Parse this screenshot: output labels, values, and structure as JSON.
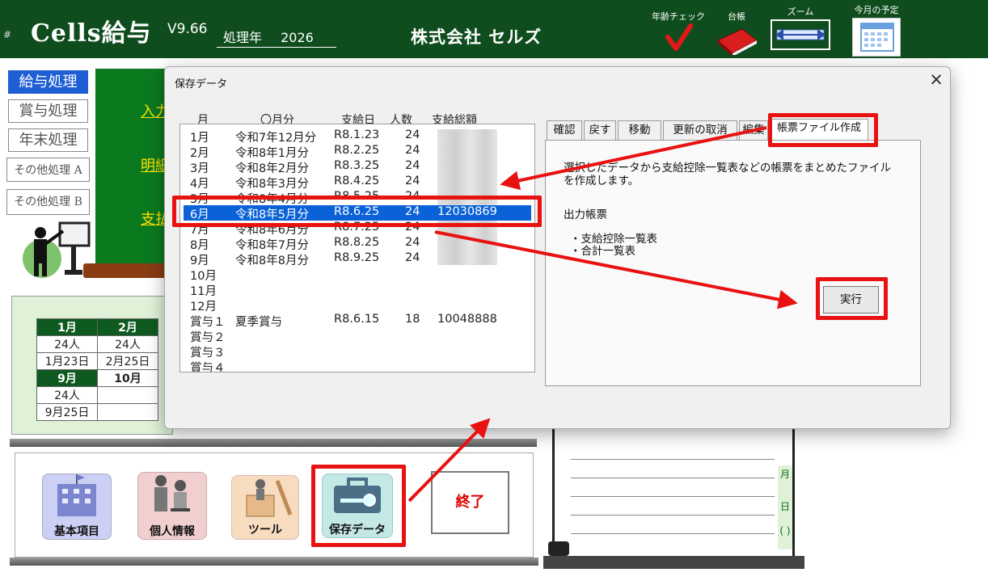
{
  "header": {
    "hash": "#",
    "app_name": "Cells給与",
    "version": "V9.66",
    "year_label": "処理年",
    "year_value": "2026",
    "company": "株式会社 セルズ",
    "tools": {
      "age_check": "年齢チェック",
      "ledger": "台帳",
      "zoom": "ズーム",
      "monthly_schedule": "今月の予定"
    }
  },
  "sidebar": {
    "items": [
      {
        "label": "給与処理"
      },
      {
        "label": "賞与処理"
      },
      {
        "label": "年末処理"
      },
      {
        "label": "その他処理 A"
      },
      {
        "label": "その他処理 B"
      }
    ]
  },
  "main_links": [
    "入力",
    "明細",
    "支払"
  ],
  "calendar": {
    "row1_months": [
      "1月",
      "2月"
    ],
    "row1_people": [
      "24人",
      "24人"
    ],
    "row1_dates": [
      "1月23日",
      "2月25日"
    ],
    "row2_months": [
      "9月",
      "10月"
    ],
    "row2_people": [
      "24人",
      ""
    ],
    "row2_dates": [
      "9月25日",
      ""
    ]
  },
  "bottom_toolbar": {
    "basic": "基本項目",
    "personal": "個人情報",
    "tools": "ツール",
    "saved_data": "保存データ",
    "exit": "終了"
  },
  "right_panel": {
    "month_char": "月",
    "day_char": "日"
  },
  "dialog": {
    "title": "保存データ",
    "close": "×",
    "columns": [
      "月",
      "〇月分",
      "支給日",
      "人数",
      "支給総額"
    ],
    "rows": [
      {
        "m": "1月",
        "period": "令和7年12月分",
        "pay": "R8.1.23",
        "count": "24",
        "total": ""
      },
      {
        "m": "2月",
        "period": "令和8年1月分",
        "pay": "R8.2.25",
        "count": "24",
        "total": ""
      },
      {
        "m": "3月",
        "period": "令和8年2月分",
        "pay": "R8.3.25",
        "count": "24",
        "total": ""
      },
      {
        "m": "4月",
        "period": "令和8年3月分",
        "pay": "R8.4.25",
        "count": "24",
        "total": ""
      },
      {
        "m": "5月",
        "period": "令和8年4月分",
        "pay": "R8.5.25",
        "count": "24",
        "total": ""
      },
      {
        "m": "6月",
        "period": "令和8年5月分",
        "pay": "R8.6.25",
        "count": "24",
        "total": "12030869"
      },
      {
        "m": "7月",
        "period": "令和8年6月分",
        "pay": "R8.7.25",
        "count": "24",
        "total": ""
      },
      {
        "m": "8月",
        "period": "令和8年7月分",
        "pay": "R8.8.25",
        "count": "24",
        "total": ""
      },
      {
        "m": "9月",
        "period": "令和8年8月分",
        "pay": "R8.9.25",
        "count": "24",
        "total": ""
      },
      {
        "m": "10月",
        "period": "",
        "pay": "",
        "count": "",
        "total": ""
      },
      {
        "m": "11月",
        "period": "",
        "pay": "",
        "count": "",
        "total": ""
      },
      {
        "m": "12月",
        "period": "",
        "pay": "",
        "count": "",
        "total": ""
      },
      {
        "m": "賞与１",
        "period": "夏季賞与",
        "pay": "R8.6.15",
        "count": "18",
        "total": "10048888"
      },
      {
        "m": "賞与２",
        "period": "",
        "pay": "",
        "count": "",
        "total": ""
      },
      {
        "m": "賞与３",
        "period": "",
        "pay": "",
        "count": "",
        "total": ""
      },
      {
        "m": "賞与４",
        "period": "",
        "pay": "",
        "count": "",
        "total": ""
      }
    ],
    "tabs": [
      "確認",
      "戻す",
      "移動",
      "更新の取消",
      "編集",
      "帳票ファイル作成"
    ],
    "active_tab": "帳票ファイル作成",
    "description": "選択したデータから支給控除一覧表などの帳票をまとめたファイルを作成します。",
    "output_heading": "出力帳票",
    "outputs": [
      "・支給控除一覧表",
      "・合計一覧表"
    ],
    "execute": "実行"
  },
  "colors": {
    "header_bg": "#0f4d1e",
    "selection": "#0b62d8",
    "highlight_red": "#e81212"
  }
}
